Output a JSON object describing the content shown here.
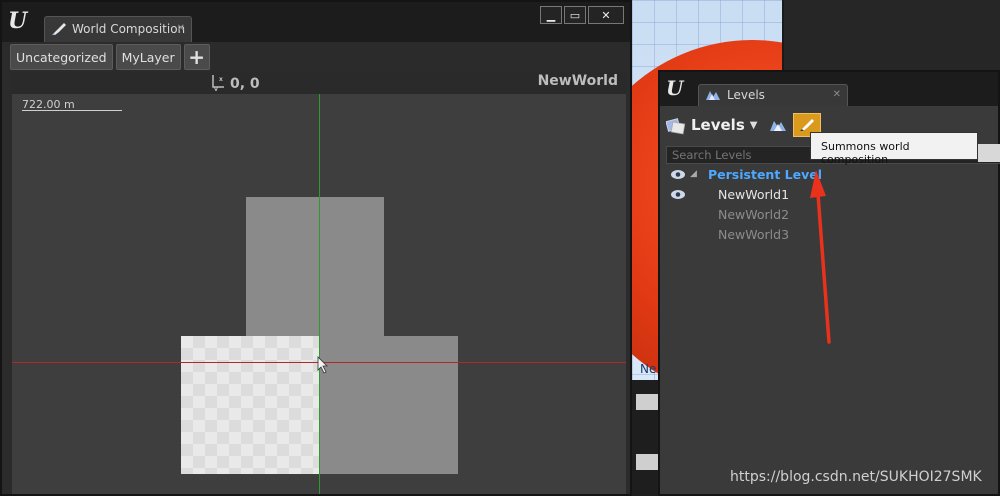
{
  "world_composition": {
    "tab_title": "World Composition",
    "layers": [
      "Uncategorized",
      "MyLayer"
    ],
    "add_layer_label": "+",
    "coordinate_readout": "0, 0",
    "world_name": "NewWorld",
    "scale_label": "722.00 m"
  },
  "window_buttons": {
    "minimize": "▁",
    "maximize": "▭",
    "close": "✕"
  },
  "levels": {
    "tab_title": "Levels",
    "toolbar_label": "Levels",
    "search_placeholder": "Search Levels",
    "tooltip": "Summons world composition",
    "persistent_level": "Persistent Level",
    "sublevels": [
      {
        "name": "NewWorld1",
        "loaded": true
      },
      {
        "name": "NewWorld2",
        "loaded": false
      },
      {
        "name": "NewWorld3",
        "loaded": false
      }
    ]
  },
  "background_text": "Ne",
  "watermark": "https://blog.csdn.net/SUKHOI27SMK",
  "colors": {
    "accent_button": "#d99a1e",
    "persistent_level": "#4da9ff",
    "annotation_arrow": "#e8321c",
    "x_axis": "#b02828",
    "y_axis": "#2e9a2e"
  }
}
